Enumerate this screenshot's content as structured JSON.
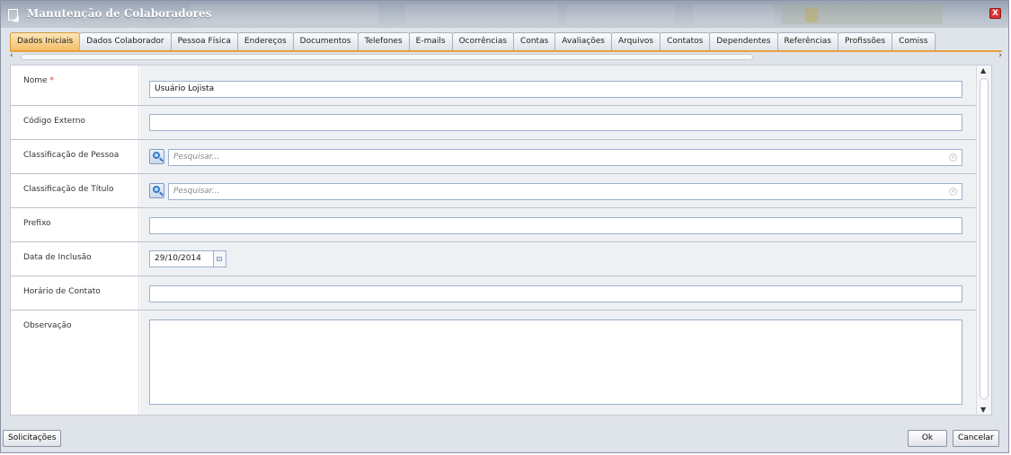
{
  "window": {
    "title": "Manutenção de Colaboradores",
    "close_label": "X"
  },
  "tabs": [
    {
      "label": "Dados Iniciais",
      "active": true
    },
    {
      "label": "Dados Colaborador"
    },
    {
      "label": "Pessoa Física"
    },
    {
      "label": "Endereços"
    },
    {
      "label": "Documentos"
    },
    {
      "label": "Telefones"
    },
    {
      "label": "E-mails"
    },
    {
      "label": "Ocorrências"
    },
    {
      "label": "Contas"
    },
    {
      "label": "Avaliações"
    },
    {
      "label": "Arquivos"
    },
    {
      "label": "Contatos"
    },
    {
      "label": "Dependentes"
    },
    {
      "label": "Referências"
    },
    {
      "label": "Profissões"
    },
    {
      "label": "Comiss"
    }
  ],
  "tab_scroll": {
    "left": "‹",
    "right": "›"
  },
  "form": {
    "nome": {
      "label": "Nome",
      "required_mark": "*",
      "value": "Usuário Lojista"
    },
    "codigo_externo": {
      "label": "Código Externo",
      "value": ""
    },
    "classificacao_pessoa": {
      "label": "Classificação de Pessoa",
      "placeholder": "Pesquisar..."
    },
    "classificacao_titulo": {
      "label": "Classificação de Título",
      "placeholder": "Pesquisar..."
    },
    "prefixo": {
      "label": "Prefixo",
      "value": ""
    },
    "data_inclusao": {
      "label": "Data de Inclusão",
      "value": "29/10/2014"
    },
    "horario_contato": {
      "label": "Horário de Contato",
      "value": ""
    },
    "observacao": {
      "label": "Observação",
      "value": ""
    }
  },
  "footer": {
    "solicitacoes": "Solicitações",
    "ok": "Ok",
    "cancelar": "Cancelar"
  },
  "colors": {
    "accent": "#e8a13a",
    "active_tab": "#f4c06a",
    "close": "#dd3333",
    "required": "#ee2222"
  },
  "icons": {
    "lookup": "search-icon",
    "calendar": "calendar-icon",
    "clear": "clear-icon"
  }
}
